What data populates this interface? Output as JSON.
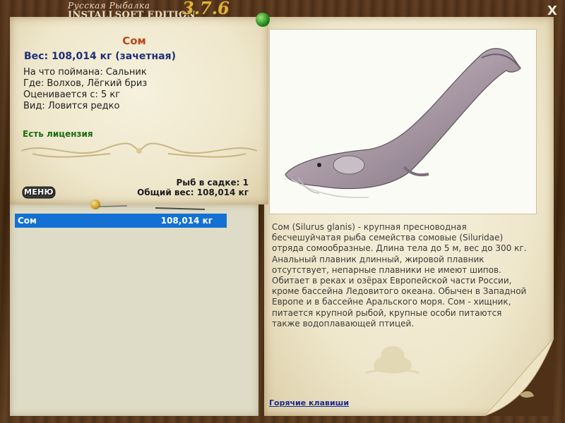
{
  "logo": {
    "line1": "Русская Рыбалка",
    "line2": "INSTALLSOFT EDITION",
    "version": "3.7.6"
  },
  "window": {
    "close_label": "X"
  },
  "fish": {
    "name": "Сом",
    "weight": "Вес: 108,014 кг (зачетная)",
    "caught_on": "На что поймана: Сальник",
    "where": "Где: Волхов, Лёгкий бриз",
    "rated_from": "Оценивается с: 5 кг",
    "type": "Вид: Ловится редко",
    "license": "Есть лицензия"
  },
  "cage": {
    "count": "Рыб в садке: 1",
    "total_weight": "Общий вес: 108,014 кг"
  },
  "menu": {
    "label": "МЕНЮ"
  },
  "catch_list": [
    {
      "name": "Сом",
      "weight": "108,014 кг"
    }
  ],
  "description": "Сом (Silurus glanis) - крупная пресноводная бесчешуйчатая рыба семейства сомовые (Siluridae) отряда сомообразные. Длина тела до 5 м, вес до 300 кг. Анальный плавник длинный, жировой плавник отсутствует, непарные плавники не имеют шипов. Обитает в реках и озёрах Европейской части России, кроме бассейна Ледовитого океана. Обычен в Западной Европе и в бассейне Аральского моря. Сом - хищник, питается крупной рыбой, крупные особи питаются также водоплавающей птицей.",
  "hotkeys": {
    "label": "Горячие клавиши"
  },
  "colors": {
    "title_orange": "#b8481a",
    "weight_blue": "#1e2f7a",
    "license_green": "#1b6b12",
    "selection_blue": "#1371d3"
  }
}
